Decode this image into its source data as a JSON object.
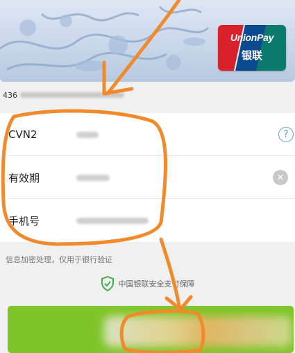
{
  "card": {
    "brand": "UnionPay",
    "brand_cn": "银联",
    "number_prefix": "436"
  },
  "form": {
    "rows": [
      {
        "label": "CVN2"
      },
      {
        "label": "有效期"
      },
      {
        "label": "手机号"
      }
    ],
    "help_icon_glyph": "?",
    "clear_icon_glyph": "✕"
  },
  "notice": "信息加密处理，仅用于银行验证",
  "secure_text": "中国银联安全支付保障",
  "colors": {
    "accent_green": "#7fc52a",
    "help_blue": "#5aa0e6",
    "annotation_orange": "#f08a2a",
    "shield_green": "#3fae49"
  },
  "icons": {
    "help": "question-circle-icon",
    "clear": "clear-circle-icon",
    "secure": "shield-check-icon"
  }
}
